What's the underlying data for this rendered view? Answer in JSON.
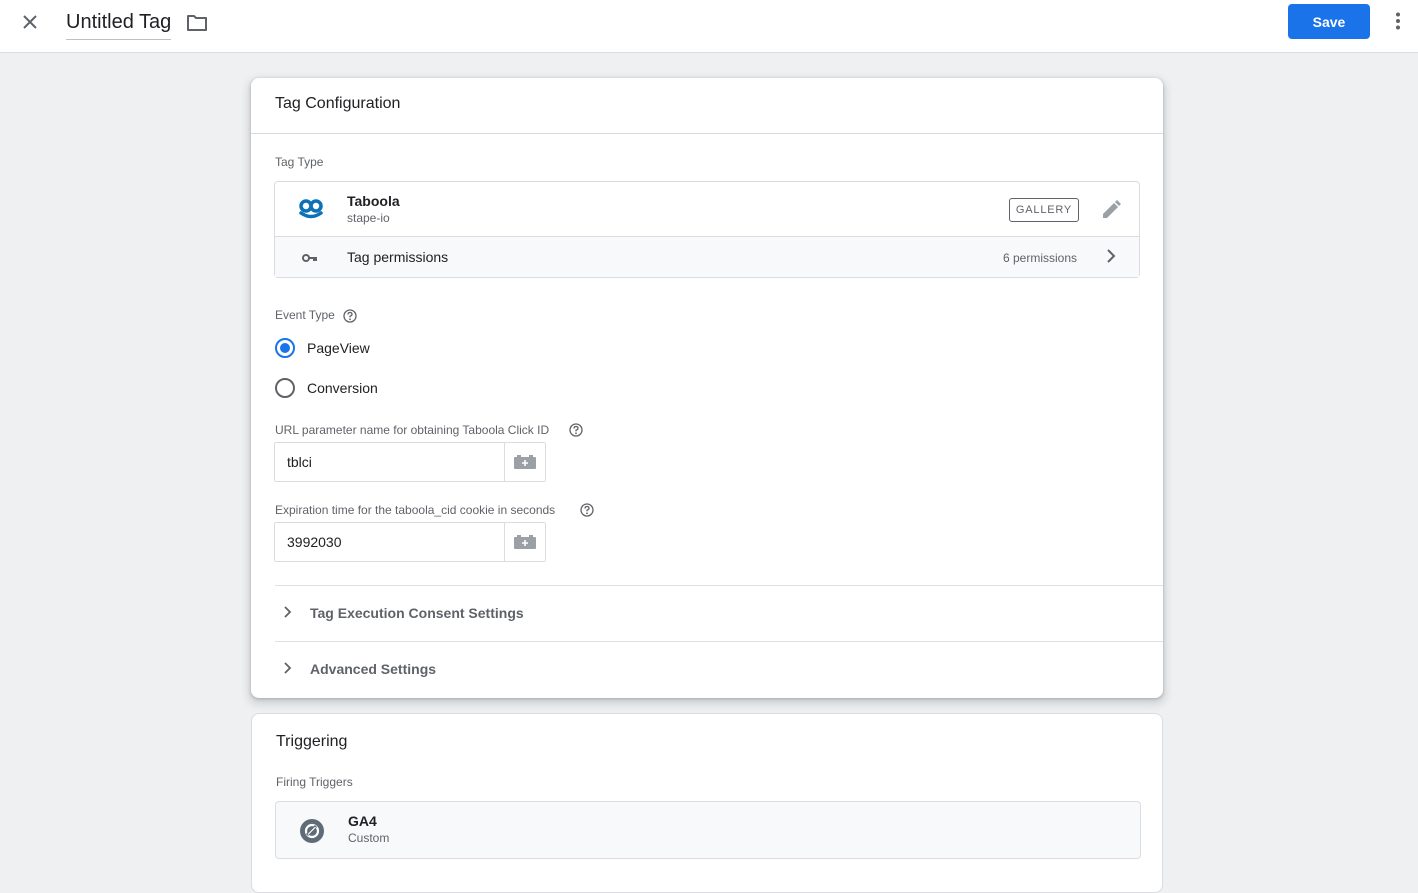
{
  "header": {
    "title": "Untitled Tag",
    "save_label": "Save"
  },
  "tag_configuration": {
    "heading": "Tag Configuration",
    "tag_type_label": "Tag Type",
    "tag_type": {
      "name": "Taboola",
      "publisher": "stape-io",
      "badge": "GALLERY",
      "icon": "taboola-logo",
      "permissions_label": "Tag permissions",
      "permissions_count": "6 permissions"
    },
    "event_type": {
      "label": "Event Type",
      "options": [
        "PageView",
        "Conversion"
      ],
      "selected": "PageView"
    },
    "url_param": {
      "label": "URL parameter name for obtaining Taboola Click ID",
      "value": "tblci"
    },
    "expiration": {
      "label": "Expiration time for the taboola_cid cookie in seconds",
      "value": "3992030"
    },
    "sections": [
      "Tag Execution Consent Settings",
      "Advanced Settings"
    ]
  },
  "triggering": {
    "heading": "Triggering",
    "firing_label": "Firing Triggers",
    "trigger": {
      "name": "GA4",
      "type": "Custom",
      "icon": "custom-event-trigger-icon"
    }
  },
  "colors": {
    "accent": "#1a73e8",
    "taboola_blue": "#0d71b9",
    "text_secondary": "#5f6368"
  }
}
